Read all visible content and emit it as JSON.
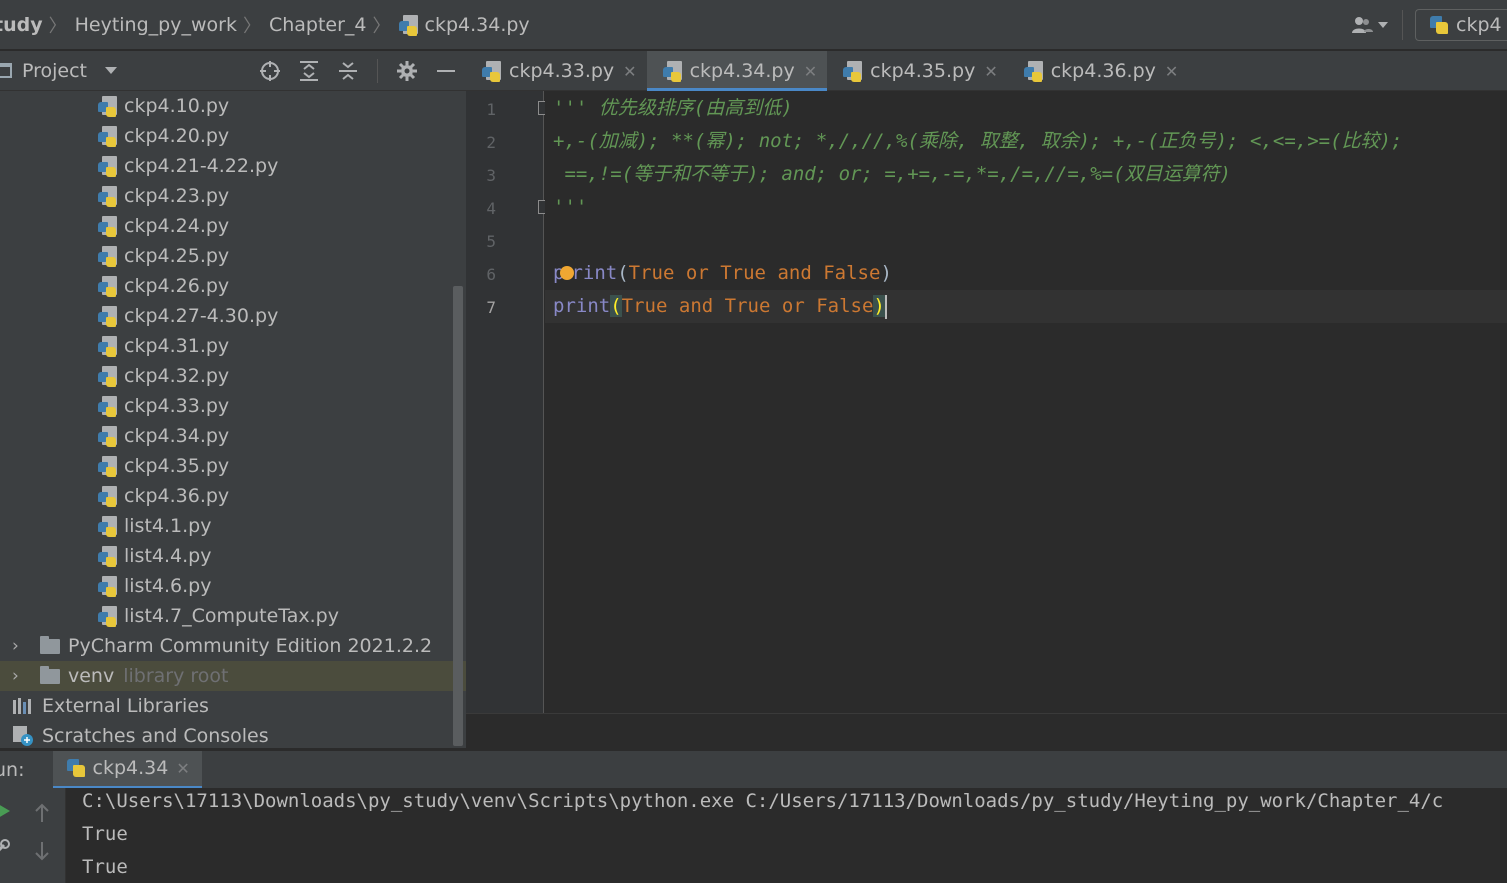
{
  "breadcrumbs": [
    {
      "label": "tudy"
    },
    {
      "label": "Heyting_py_work"
    },
    {
      "label": "Chapter_4"
    },
    {
      "label": "ckp4.34.py"
    }
  ],
  "run_config": {
    "label": "ckp4"
  },
  "project_pane": {
    "title": "Project",
    "tree": [
      {
        "label": "ckp4.10.py"
      },
      {
        "label": "ckp4.20.py"
      },
      {
        "label": "ckp4.21-4.22.py"
      },
      {
        "label": "ckp4.23.py"
      },
      {
        "label": "ckp4.24.py"
      },
      {
        "label": "ckp4.25.py"
      },
      {
        "label": "ckp4.26.py"
      },
      {
        "label": "ckp4.27-4.30.py"
      },
      {
        "label": "ckp4.31.py"
      },
      {
        "label": "ckp4.32.py"
      },
      {
        "label": "ckp4.33.py"
      },
      {
        "label": "ckp4.34.py"
      },
      {
        "label": "ckp4.35.py"
      },
      {
        "label": "ckp4.36.py"
      },
      {
        "label": "list4.1.py"
      },
      {
        "label": "list4.4.py"
      },
      {
        "label": "list4.6.py"
      },
      {
        "label": "list4.7_ComputeTax.py"
      }
    ],
    "folders": [
      {
        "label": "PyCharm Community Edition 2021.2.2",
        "hint": ""
      },
      {
        "label": "venv",
        "hint": "library root"
      }
    ],
    "external_libraries": "External Libraries",
    "scratches": "Scratches and Consoles"
  },
  "editor_tabs": [
    {
      "label": "ckp4.33.py",
      "active": false
    },
    {
      "label": "ckp4.34.py",
      "active": true
    },
    {
      "label": "ckp4.35.py",
      "active": false
    },
    {
      "label": "ckp4.36.py",
      "active": false
    }
  ],
  "editor": {
    "line_numbers": [
      "1",
      "2",
      "3",
      "4",
      "5",
      "6",
      "7"
    ],
    "current_line": "7",
    "lines": {
      "l1": "''' 优先级排序(由高到低)",
      "l2": "+,-(加减); **(幂); not; *,/,//,%(乘除, 取整, 取余); +,-(正负号); <,<=,>=(比较);",
      "l3": " ==,!=(等于和不等于); and; or; =,+=,-=,*=,/=,//=,%=(双目运算符)",
      "l4": "'''",
      "l6": {
        "p": "p",
        "rint": "rint",
        "open": "(",
        "t1": "True",
        "or": "or",
        "t2": "True",
        "and": "and",
        "f": "False",
        "close": ")"
      },
      "l7": {
        "print": "print",
        "open": "(",
        "t1": "True",
        "and": "and",
        "t2": "True",
        "or": "or",
        "f": "False",
        "close": ")"
      }
    }
  },
  "run_panel": {
    "label": "un:",
    "tab": "ckp4.34",
    "output": [
      "C:\\Users\\17113\\Downloads\\py_study\\venv\\Scripts\\python.exe C:/Users/17113/Downloads/py_study/Heyting_py_work/Chapter_4/c",
      "True",
      "True"
    ]
  },
  "colors": {
    "background": "#2b2b2b",
    "panel": "#3c3f41",
    "keyword": "#cc7832",
    "builtin": "#8888c6",
    "docstring": "#629755",
    "tab_underline": "#4a88c7"
  }
}
